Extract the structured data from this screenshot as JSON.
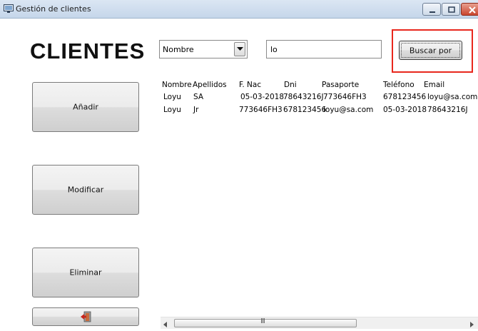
{
  "window": {
    "title": "Gestión de clientes"
  },
  "header": {
    "heading": "CLIENTES"
  },
  "search": {
    "field_selected": "Nombre",
    "query_value": "lo",
    "button_label": "Buscar por"
  },
  "actions": {
    "add_label": "Añadir",
    "edit_label": "Modificar",
    "delete_label": "Eliminar"
  },
  "table": {
    "headers": [
      "Nombre",
      "Apellidos",
      "F. Nac",
      "Dni",
      "Pasaporte",
      "Teléfono",
      "Email"
    ],
    "rows": [
      [
        "Loyu",
        "SA",
        "05-03-2018",
        "78643216J",
        "773646FH3",
        "678123456",
        "loyu@sa.com"
      ],
      [
        "Loyu",
        "Jr",
        "773646FH3",
        "678123456",
        "loyu@sa.com",
        "05-03-2018",
        "78643216J"
      ]
    ]
  },
  "scrollbar": {
    "grip": "III"
  },
  "colors": {
    "highlight": "#e8271d",
    "titlebar": "#c5d6ea"
  },
  "icons": {
    "app": "window-app-icon",
    "exit": "exit-door-icon"
  }
}
